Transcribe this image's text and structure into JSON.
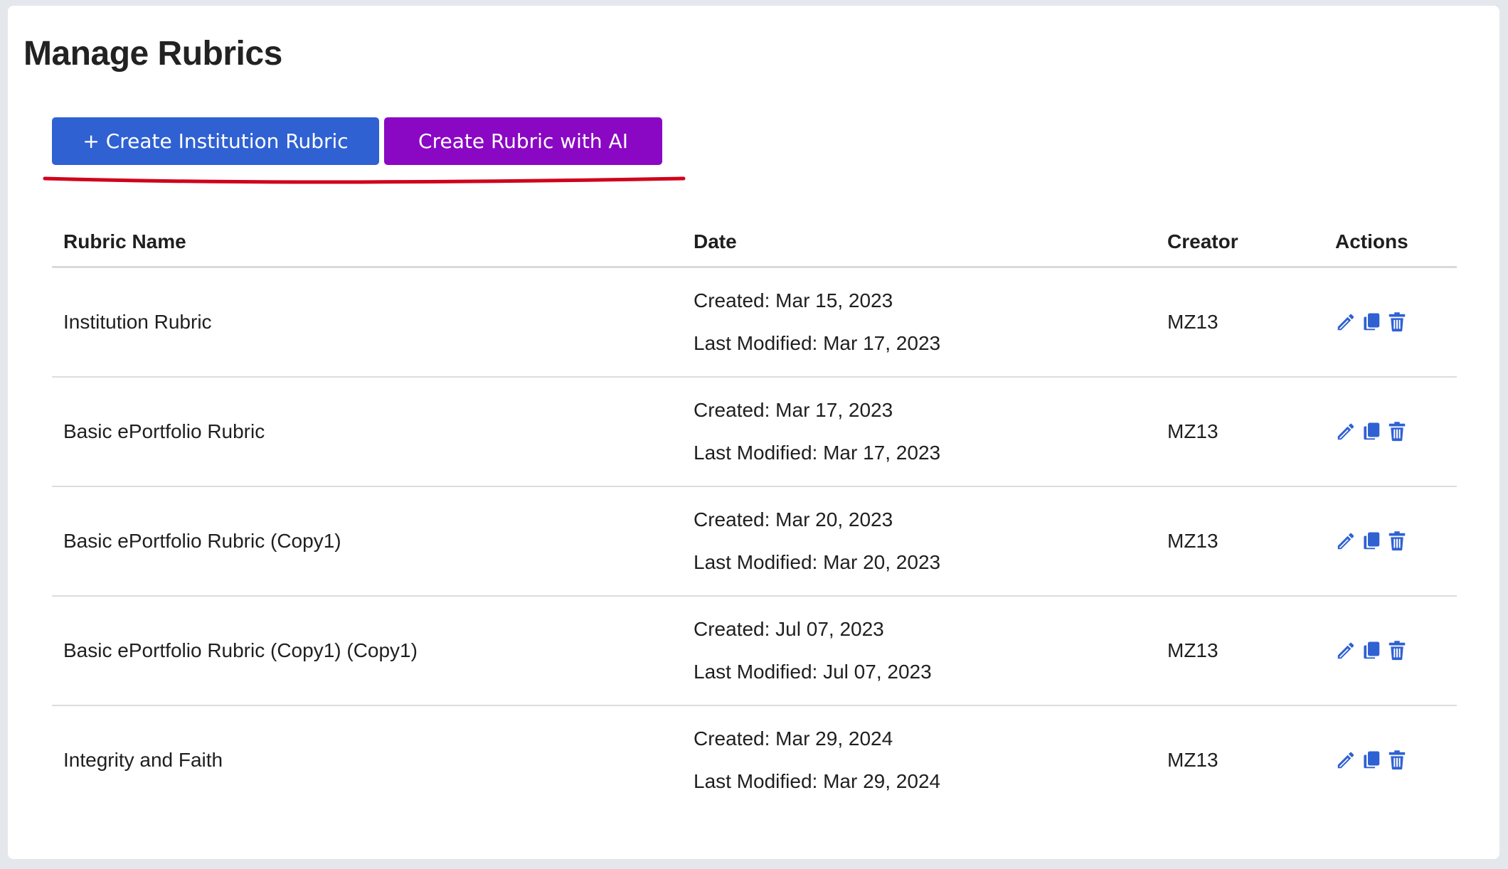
{
  "page": {
    "title": "Manage Rubrics"
  },
  "toolbar": {
    "create_institution_label": "+ Create Institution Rubric",
    "create_ai_label": "Create Rubric with AI"
  },
  "table": {
    "headers": {
      "name": "Rubric Name",
      "date": "Date",
      "creator": "Creator",
      "actions": "Actions"
    },
    "rows": [
      {
        "name": "Institution Rubric",
        "created": "Created: Mar 15, 2023",
        "modified": "Last Modified: Mar 17, 2023",
        "creator": "MZ13"
      },
      {
        "name": "Basic ePortfolio Rubric",
        "created": "Created: Mar 17, 2023",
        "modified": "Last Modified: Mar 17, 2023",
        "creator": "MZ13"
      },
      {
        "name": "Basic ePortfolio Rubric (Copy1)",
        "created": "Created: Mar 20, 2023",
        "modified": "Last Modified: Mar 20, 2023",
        "creator": "MZ13"
      },
      {
        "name": "Basic ePortfolio Rubric (Copy1) (Copy1)",
        "created": "Created: Jul 07, 2023",
        "modified": "Last Modified: Jul 07, 2023",
        "creator": "MZ13"
      },
      {
        "name": "Integrity and Faith",
        "created": "Created: Mar 29, 2024",
        "modified": "Last Modified: Mar 29, 2024",
        "creator": "MZ13"
      }
    ],
    "row_actions": [
      "edit-icon",
      "copy-icon",
      "trash-icon"
    ]
  },
  "colors": {
    "primary_button": "#2f61d3",
    "ai_button": "#8a08c4",
    "action_icon": "#2f61d3",
    "highlight_underline": "#d0021b",
    "background": "#e4e7eb"
  }
}
